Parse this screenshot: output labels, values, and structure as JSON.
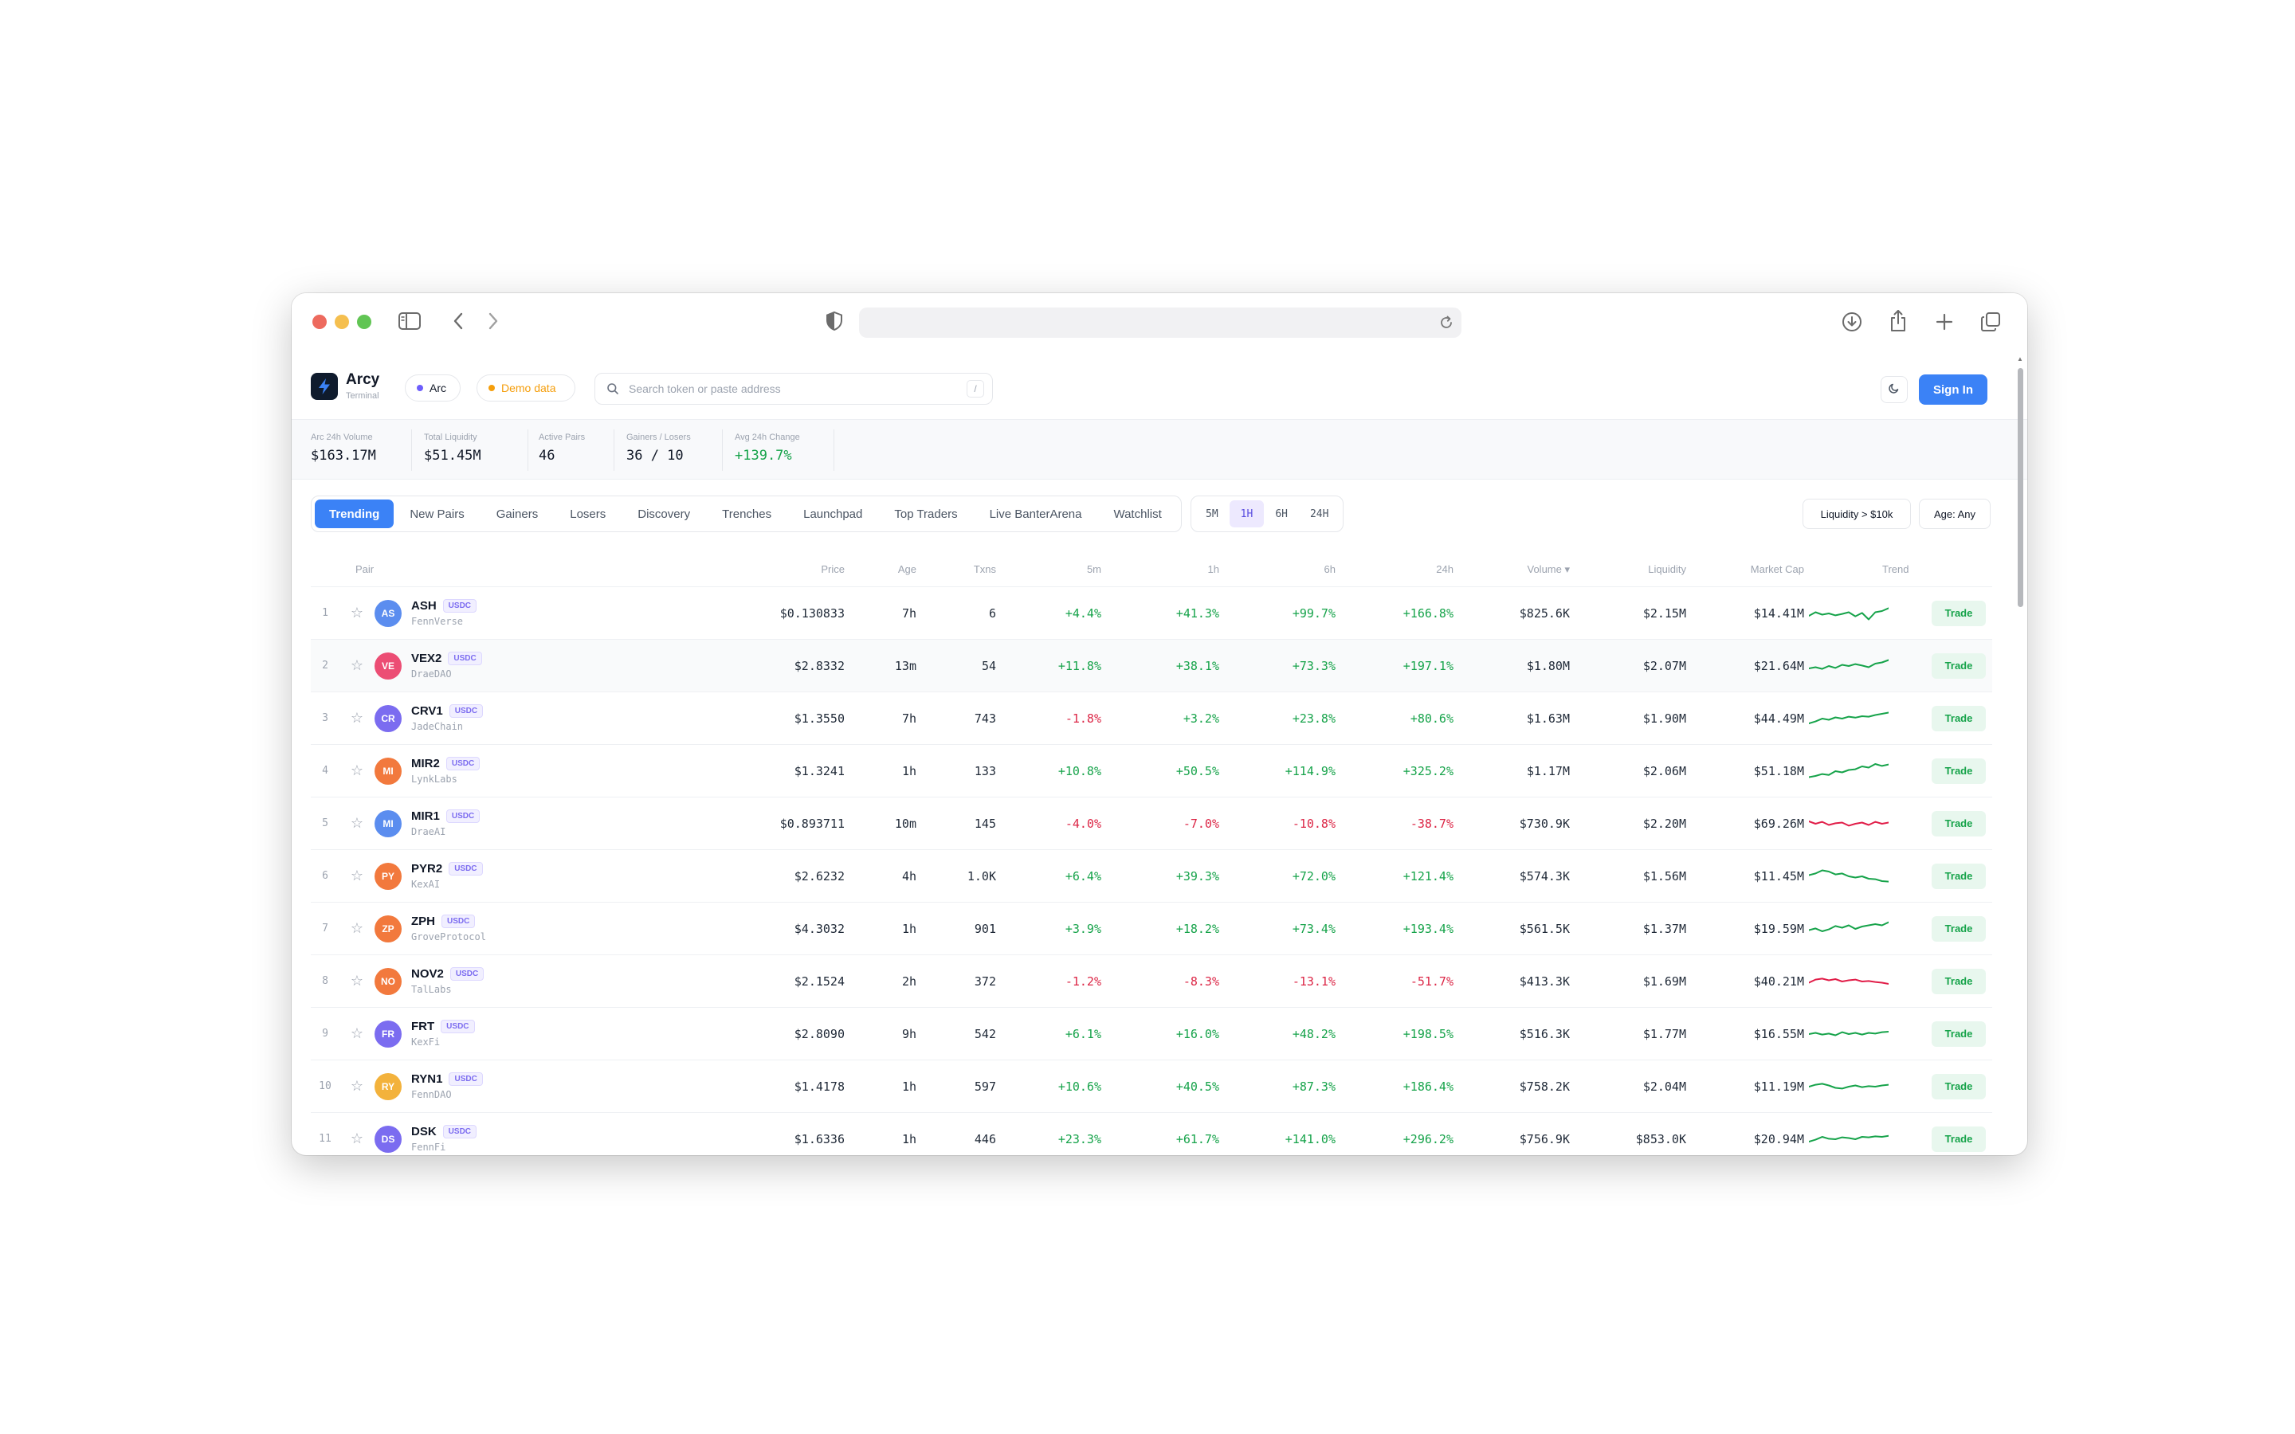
{
  "header": {
    "brand_name": "Arcy",
    "brand_sub": "Terminal",
    "network_label": "Arc",
    "demo_label": "Demo data",
    "search_placeholder": "Search token or paste address",
    "search_shortcut": "/",
    "sign_in": "Sign In"
  },
  "stats": [
    {
      "label": "Arc 24h Volume",
      "value": "$163.17M"
    },
    {
      "label": "Total Liquidity",
      "value": "$51.45M"
    },
    {
      "label": "Active Pairs",
      "value": "46"
    },
    {
      "label": "Gainers / Losers",
      "value": "36 / 10"
    },
    {
      "label": "Avg 24h Change",
      "value": "+139.7%"
    }
  ],
  "tabs": [
    "Trending",
    "New Pairs",
    "Gainers",
    "Losers",
    "Discovery",
    "Trenches",
    "Launchpad",
    "Top Traders",
    "Live BanterArena",
    "Watchlist"
  ],
  "active_tab": "Trending",
  "timeframes": [
    "5M",
    "1H",
    "6H",
    "24H"
  ],
  "active_timeframe": "1H",
  "filters": {
    "liquidity": "Liquidity > $10k",
    "age": "Age: Any"
  },
  "columns": {
    "pair": "Pair",
    "price": "Price",
    "age": "Age",
    "txns": "Txns",
    "m5": "5m",
    "h1": "1h",
    "h6": "6h",
    "h24": "24h",
    "volume": "Volume ▾",
    "liquidity": "Liquidity",
    "mcap": "Market Cap",
    "trend": "Trend"
  },
  "trade_label": "Trade",
  "quote_label": "USDC",
  "rows": [
    {
      "rank": "1",
      "initials": "AS",
      "avatar_color": "#5b8def",
      "symbol": "ASH",
      "project": "FennVerse",
      "price": "$0.130833",
      "age": "7h",
      "txns": "6",
      "m5": "+4.4%",
      "h1": "+41.3%",
      "h6": "+99.7%",
      "h24": "+166.8%",
      "volume": "$825.6K",
      "liquidity": "$2.15M",
      "mcap": "$14.41M",
      "trend_dir": "up",
      "spark": [
        0.6,
        0.45,
        0.55,
        0.5,
        0.58,
        0.52,
        0.45,
        0.62,
        0.48,
        0.75,
        0.45,
        0.4,
        0.28
      ]
    },
    {
      "rank": "2",
      "initials": "VE",
      "avatar_color": "#ec4d74",
      "symbol": "VEX2",
      "project": "DraeDAO",
      "price": "$2.8332",
      "age": "13m",
      "txns": "54",
      "m5": "+11.8%",
      "h1": "+38.1%",
      "h6": "+73.3%",
      "h24": "+197.1%",
      "volume": "$1.80M",
      "liquidity": "$2.07M",
      "mcap": "$21.64M",
      "trend_dir": "up",
      "spark": [
        0.6,
        0.55,
        0.62,
        0.5,
        0.58,
        0.45,
        0.5,
        0.42,
        0.48,
        0.55,
        0.4,
        0.35,
        0.25
      ]
    },
    {
      "rank": "3",
      "initials": "CR",
      "avatar_color": "#7b6cf0",
      "symbol": "CRV1",
      "project": "JadeChain",
      "price": "$1.3550",
      "age": "7h",
      "txns": "743",
      "m5": "-1.8%",
      "h1": "+3.2%",
      "h6": "+23.8%",
      "h24": "+80.6%",
      "volume": "$1.63M",
      "liquidity": "$1.90M",
      "mcap": "$44.49M",
      "trend_dir": "up",
      "spark": [
        0.7,
        0.62,
        0.5,
        0.55,
        0.45,
        0.5,
        0.42,
        0.46,
        0.4,
        0.42,
        0.35,
        0.3,
        0.25
      ]
    },
    {
      "rank": "4",
      "initials": "MI",
      "avatar_color": "#f2793d",
      "symbol": "MIR2",
      "project": "LynkLabs",
      "price": "$1.3241",
      "age": "1h",
      "txns": "133",
      "m5": "+10.8%",
      "h1": "+50.5%",
      "h6": "+114.9%",
      "h24": "+325.2%",
      "volume": "$1.17M",
      "liquidity": "$2.06M",
      "mcap": "$51.18M",
      "trend_dir": "up",
      "spark": [
        0.75,
        0.7,
        0.62,
        0.66,
        0.5,
        0.55,
        0.45,
        0.42,
        0.3,
        0.35,
        0.2,
        0.28,
        0.22
      ]
    },
    {
      "rank": "5",
      "initials": "MI",
      "avatar_color": "#5b8def",
      "symbol": "MIR1",
      "project": "DraeAI",
      "price": "$0.893711",
      "age": "10m",
      "txns": "145",
      "m5": "-4.0%",
      "h1": "-7.0%",
      "h6": "-10.8%",
      "h24": "-38.7%",
      "volume": "$730.9K",
      "liquidity": "$2.20M",
      "mcap": "$69.26M",
      "trend_dir": "down",
      "spark": [
        0.4,
        0.5,
        0.42,
        0.55,
        0.48,
        0.45,
        0.58,
        0.5,
        0.45,
        0.55,
        0.42,
        0.5,
        0.45
      ]
    },
    {
      "rank": "6",
      "initials": "PY",
      "avatar_color": "#f2793d",
      "symbol": "PYR2",
      "project": "KexAI",
      "price": "$2.6232",
      "age": "4h",
      "txns": "1.0K",
      "m5": "+6.4%",
      "h1": "+39.3%",
      "h6": "+72.0%",
      "h24": "+121.4%",
      "volume": "$574.3K",
      "liquidity": "$1.56M",
      "mcap": "$11.45M",
      "trend_dir": "up",
      "spark": [
        0.45,
        0.38,
        0.25,
        0.3,
        0.42,
        0.38,
        0.5,
        0.55,
        0.5,
        0.6,
        0.62,
        0.7,
        0.72
      ]
    },
    {
      "rank": "7",
      "initials": "ZP",
      "avatar_color": "#f2793d",
      "symbol": "ZPH",
      "project": "GroveProtocol",
      "price": "$4.3032",
      "age": "1h",
      "txns": "901",
      "m5": "+3.9%",
      "h1": "+18.2%",
      "h6": "+73.4%",
      "h24": "+193.4%",
      "volume": "$561.5K",
      "liquidity": "$1.37M",
      "mcap": "$19.59M",
      "trend_dir": "up",
      "spark": [
        0.55,
        0.48,
        0.6,
        0.52,
        0.38,
        0.45,
        0.35,
        0.5,
        0.4,
        0.35,
        0.3,
        0.35,
        0.22
      ]
    },
    {
      "rank": "8",
      "initials": "NO",
      "avatar_color": "#f2793d",
      "symbol": "NOV2",
      "project": "TalLabs",
      "price": "$2.1524",
      "age": "2h",
      "txns": "372",
      "m5": "-1.2%",
      "h1": "-8.3%",
      "h6": "-13.1%",
      "h24": "-51.7%",
      "volume": "$413.3K",
      "liquidity": "$1.69M",
      "mcap": "$40.21M",
      "trend_dir": "down",
      "spark": [
        0.55,
        0.42,
        0.38,
        0.45,
        0.4,
        0.5,
        0.45,
        0.42,
        0.5,
        0.48,
        0.52,
        0.55,
        0.6
      ]
    },
    {
      "rank": "9",
      "initials": "FR",
      "avatar_color": "#7b6cf0",
      "symbol": "FRT",
      "project": "KexFi",
      "price": "$2.8090",
      "age": "9h",
      "txns": "542",
      "m5": "+6.1%",
      "h1": "+16.0%",
      "h6": "+48.2%",
      "h24": "+198.5%",
      "volume": "$516.3K",
      "liquidity": "$1.77M",
      "mcap": "$16.55M",
      "trend_dir": "up",
      "spark": [
        0.5,
        0.45,
        0.52,
        0.48,
        0.55,
        0.42,
        0.5,
        0.45,
        0.52,
        0.45,
        0.48,
        0.42,
        0.4
      ]
    },
    {
      "rank": "10",
      "initials": "RY",
      "avatar_color": "#f3b23c",
      "symbol": "RYN1",
      "project": "FennDAO",
      "price": "$1.4178",
      "age": "1h",
      "txns": "597",
      "m5": "+10.6%",
      "h1": "+40.5%",
      "h6": "+87.3%",
      "h24": "+186.4%",
      "volume": "$758.2K",
      "liquidity": "$2.04M",
      "mcap": "$11.19M",
      "trend_dir": "up",
      "spark": [
        0.5,
        0.42,
        0.38,
        0.45,
        0.55,
        0.58,
        0.5,
        0.45,
        0.52,
        0.48,
        0.5,
        0.45,
        0.42
      ]
    },
    {
      "rank": "11",
      "initials": "DS",
      "avatar_color": "#7b6cf0",
      "symbol": "DSK",
      "project": "FennFi",
      "price": "$1.6336",
      "age": "1h",
      "txns": "446",
      "m5": "+23.3%",
      "h1": "+61.7%",
      "h6": "+141.0%",
      "h24": "+296.2%",
      "volume": "$756.9K",
      "liquidity": "$853.0K",
      "mcap": "$20.94M",
      "trend_dir": "up",
      "spark": [
        0.6,
        0.52,
        0.4,
        0.48,
        0.5,
        0.42,
        0.45,
        0.5,
        0.4,
        0.42,
        0.38,
        0.4,
        0.36
      ]
    }
  ],
  "colors": {
    "accent": "#3b82f6",
    "positive": "#16a34a",
    "negative": "#dc2646",
    "spark_up": "#16a34a",
    "spark_down": "#e11d48"
  },
  "icons": {
    "sidebar": "sidebar-icon",
    "back": "chevron-left-icon",
    "forward": "chevron-right-icon",
    "shield": "shield-icon",
    "reload": "reload-icon",
    "download": "download-icon",
    "share": "share-icon",
    "new_tab": "plus-icon",
    "tabs": "tabs-overview-icon",
    "logo": "bolt-icon",
    "search": "search-icon",
    "theme": "moon-icon",
    "favorite": "star-icon"
  }
}
